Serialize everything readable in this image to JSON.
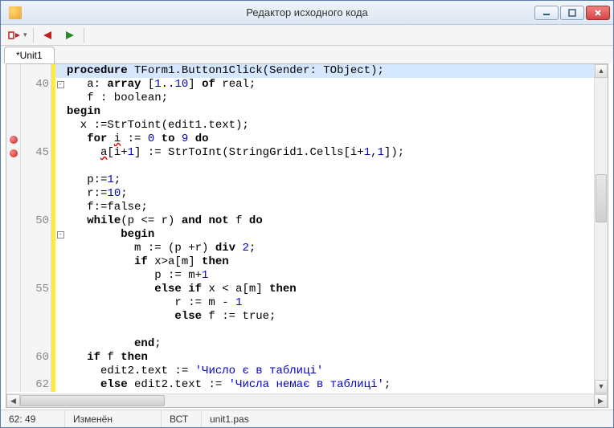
{
  "window": {
    "title": "Редактор исходного кода"
  },
  "tabs": [
    {
      "label": "*Unit1"
    }
  ],
  "code": {
    "lines": [
      {
        "num": "",
        "bp": false,
        "mod": true,
        "fold": "",
        "hl": true,
        "tokens": [
          [
            "kw",
            "procedure"
          ],
          [
            "",
            " TForm1.Button1Click(Sender: TObject);"
          ]
        ]
      },
      {
        "num": "40",
        "bp": false,
        "mod": true,
        "fold": "-",
        "hl": false,
        "tokens": [
          [
            "",
            "   a: "
          ],
          [
            "kw",
            "array"
          ],
          [
            "",
            " ["
          ],
          [
            "num",
            "1"
          ],
          [
            "",
            ".."
          ],
          [
            "num",
            "10"
          ],
          [
            "",
            "] "
          ],
          [
            "kw",
            "of"
          ],
          [
            "",
            " real;"
          ]
        ]
      },
      {
        "num": "",
        "bp": false,
        "mod": true,
        "fold": "",
        "hl": false,
        "tokens": [
          [
            "",
            "   f : boolean;"
          ]
        ]
      },
      {
        "num": "",
        "bp": false,
        "mod": true,
        "fold": "",
        "hl": false,
        "tokens": [
          [
            "kw",
            "begin"
          ]
        ]
      },
      {
        "num": "",
        "bp": false,
        "mod": true,
        "fold": "",
        "hl": false,
        "tokens": [
          [
            "",
            "  x :=StrToint(edit1.text);"
          ]
        ]
      },
      {
        "num": "",
        "bp": true,
        "mod": true,
        "fold": "",
        "hl": false,
        "tokens": [
          [
            "",
            "   "
          ],
          [
            "kw",
            "for"
          ],
          [
            "",
            " "
          ],
          [
            "err",
            "i"
          ],
          [
            "",
            " := "
          ],
          [
            "num",
            "0"
          ],
          [
            "",
            " "
          ],
          [
            "kw",
            "to"
          ],
          [
            "",
            " "
          ],
          [
            "num",
            "9"
          ],
          [
            "",
            " "
          ],
          [
            "kw",
            "do"
          ]
        ]
      },
      {
        "num": "45",
        "bp": true,
        "mod": true,
        "fold": "",
        "hl": false,
        "tokens": [
          [
            "",
            "     "
          ],
          [
            "err",
            "a"
          ],
          [
            "",
            "[i+"
          ],
          [
            "num",
            "1"
          ],
          [
            "",
            "] := StrToInt(StringGrid1.Cells[i+"
          ],
          [
            "num",
            "1"
          ],
          [
            "",
            ","
          ],
          [
            "num",
            "1"
          ],
          [
            "",
            "]);"
          ]
        ]
      },
      {
        "num": "",
        "bp": false,
        "mod": true,
        "fold": "",
        "hl": false,
        "tokens": [
          [
            "",
            ""
          ]
        ]
      },
      {
        "num": "",
        "bp": false,
        "mod": true,
        "fold": "",
        "hl": false,
        "tokens": [
          [
            "",
            "   p:="
          ],
          [
            "num",
            "1"
          ],
          [
            "",
            ";"
          ]
        ]
      },
      {
        "num": "",
        "bp": false,
        "mod": true,
        "fold": "",
        "hl": false,
        "tokens": [
          [
            "",
            "   r:="
          ],
          [
            "num",
            "10"
          ],
          [
            "",
            ";"
          ]
        ]
      },
      {
        "num": "",
        "bp": false,
        "mod": true,
        "fold": "",
        "hl": false,
        "tokens": [
          [
            "",
            "   f:=false;"
          ]
        ]
      },
      {
        "num": "50",
        "bp": false,
        "mod": true,
        "fold": "",
        "hl": false,
        "tokens": [
          [
            "",
            "   "
          ],
          [
            "kw",
            "while"
          ],
          [
            "",
            "(p <= r) "
          ],
          [
            "kw",
            "and"
          ],
          [
            "",
            " "
          ],
          [
            "kw",
            "not"
          ],
          [
            "",
            " f "
          ],
          [
            "kw",
            "do"
          ]
        ]
      },
      {
        "num": "",
        "bp": false,
        "mod": true,
        "fold": "-",
        "hl": false,
        "tokens": [
          [
            "",
            "        "
          ],
          [
            "kw",
            "begin"
          ]
        ]
      },
      {
        "num": "",
        "bp": false,
        "mod": true,
        "fold": "",
        "hl": false,
        "tokens": [
          [
            "",
            "          m := (p +r) "
          ],
          [
            "kw",
            "div"
          ],
          [
            "",
            " "
          ],
          [
            "num",
            "2"
          ],
          [
            "",
            ";"
          ]
        ]
      },
      {
        "num": "",
        "bp": false,
        "mod": true,
        "fold": "",
        "hl": false,
        "tokens": [
          [
            "",
            "          "
          ],
          [
            "kw",
            "if"
          ],
          [
            "",
            " x>a[m] "
          ],
          [
            "kw",
            "then"
          ]
        ]
      },
      {
        "num": "",
        "bp": false,
        "mod": true,
        "fold": "",
        "hl": false,
        "tokens": [
          [
            "",
            "             p := m+"
          ],
          [
            "num",
            "1"
          ]
        ]
      },
      {
        "num": "55",
        "bp": false,
        "mod": true,
        "fold": "",
        "hl": false,
        "tokens": [
          [
            "",
            "             "
          ],
          [
            "kw",
            "else"
          ],
          [
            "",
            " "
          ],
          [
            "kw",
            "if"
          ],
          [
            "",
            " x < a[m] "
          ],
          [
            "kw",
            "then"
          ]
        ]
      },
      {
        "num": "",
        "bp": false,
        "mod": true,
        "fold": "",
        "hl": false,
        "tokens": [
          [
            "",
            "                r := m - "
          ],
          [
            "num",
            "1"
          ]
        ]
      },
      {
        "num": "",
        "bp": false,
        "mod": true,
        "fold": "",
        "hl": false,
        "tokens": [
          [
            "",
            "                "
          ],
          [
            "kw",
            "else"
          ],
          [
            "",
            " f := true;"
          ]
        ]
      },
      {
        "num": "",
        "bp": false,
        "mod": true,
        "fold": "",
        "hl": false,
        "tokens": [
          [
            "",
            ""
          ]
        ]
      },
      {
        "num": "",
        "bp": false,
        "mod": true,
        "fold": "",
        "hl": false,
        "tokens": [
          [
            "",
            "          "
          ],
          [
            "kw",
            "end"
          ],
          [
            "",
            ";"
          ]
        ]
      },
      {
        "num": "60",
        "bp": false,
        "mod": true,
        "fold": "",
        "hl": false,
        "tokens": [
          [
            "",
            "   "
          ],
          [
            "kw",
            "if"
          ],
          [
            "",
            " f "
          ],
          [
            "kw",
            "then"
          ]
        ]
      },
      {
        "num": "",
        "bp": false,
        "mod": true,
        "fold": "",
        "hl": false,
        "tokens": [
          [
            "",
            "     edit2.text := "
          ],
          [
            "str",
            "'Число є в таблиці'"
          ]
        ]
      },
      {
        "num": "62",
        "bp": false,
        "mod": true,
        "fold": "",
        "hl": false,
        "tokens": [
          [
            "",
            "     "
          ],
          [
            "kw",
            "else"
          ],
          [
            "",
            " edit2.text := "
          ],
          [
            "str",
            "'Числа немає в таблиці'"
          ],
          [
            "",
            ";"
          ]
        ]
      }
    ]
  },
  "status": {
    "cursor": "62: 49",
    "state": "Изменён",
    "ovr": "ВСТ",
    "file": "unit1.pas"
  }
}
